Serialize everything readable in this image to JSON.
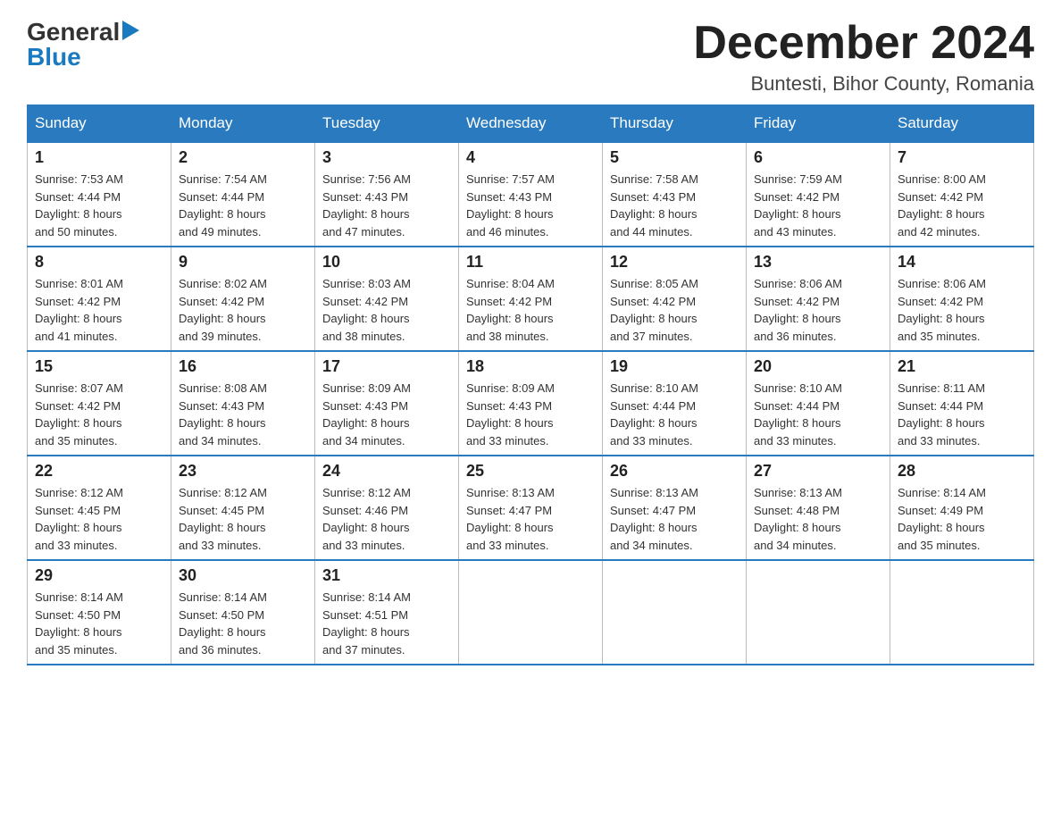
{
  "header": {
    "logo_general": "General",
    "logo_blue": "Blue",
    "month_title": "December 2024",
    "location": "Buntesti, Bihor County, Romania"
  },
  "days_of_week": [
    "Sunday",
    "Monday",
    "Tuesday",
    "Wednesday",
    "Thursday",
    "Friday",
    "Saturday"
  ],
  "weeks": [
    [
      {
        "day": "1",
        "sunrise": "7:53 AM",
        "sunset": "4:44 PM",
        "daylight": "8 hours and 50 minutes."
      },
      {
        "day": "2",
        "sunrise": "7:54 AM",
        "sunset": "4:44 PM",
        "daylight": "8 hours and 49 minutes."
      },
      {
        "day": "3",
        "sunrise": "7:56 AM",
        "sunset": "4:43 PM",
        "daylight": "8 hours and 47 minutes."
      },
      {
        "day": "4",
        "sunrise": "7:57 AM",
        "sunset": "4:43 PM",
        "daylight": "8 hours and 46 minutes."
      },
      {
        "day": "5",
        "sunrise": "7:58 AM",
        "sunset": "4:43 PM",
        "daylight": "8 hours and 44 minutes."
      },
      {
        "day": "6",
        "sunrise": "7:59 AM",
        "sunset": "4:42 PM",
        "daylight": "8 hours and 43 minutes."
      },
      {
        "day": "7",
        "sunrise": "8:00 AM",
        "sunset": "4:42 PM",
        "daylight": "8 hours and 42 minutes."
      }
    ],
    [
      {
        "day": "8",
        "sunrise": "8:01 AM",
        "sunset": "4:42 PM",
        "daylight": "8 hours and 41 minutes."
      },
      {
        "day": "9",
        "sunrise": "8:02 AM",
        "sunset": "4:42 PM",
        "daylight": "8 hours and 39 minutes."
      },
      {
        "day": "10",
        "sunrise": "8:03 AM",
        "sunset": "4:42 PM",
        "daylight": "8 hours and 38 minutes."
      },
      {
        "day": "11",
        "sunrise": "8:04 AM",
        "sunset": "4:42 PM",
        "daylight": "8 hours and 38 minutes."
      },
      {
        "day": "12",
        "sunrise": "8:05 AM",
        "sunset": "4:42 PM",
        "daylight": "8 hours and 37 minutes."
      },
      {
        "day": "13",
        "sunrise": "8:06 AM",
        "sunset": "4:42 PM",
        "daylight": "8 hours and 36 minutes."
      },
      {
        "day": "14",
        "sunrise": "8:06 AM",
        "sunset": "4:42 PM",
        "daylight": "8 hours and 35 minutes."
      }
    ],
    [
      {
        "day": "15",
        "sunrise": "8:07 AM",
        "sunset": "4:42 PM",
        "daylight": "8 hours and 35 minutes."
      },
      {
        "day": "16",
        "sunrise": "8:08 AM",
        "sunset": "4:43 PM",
        "daylight": "8 hours and 34 minutes."
      },
      {
        "day": "17",
        "sunrise": "8:09 AM",
        "sunset": "4:43 PM",
        "daylight": "8 hours and 34 minutes."
      },
      {
        "day": "18",
        "sunrise": "8:09 AM",
        "sunset": "4:43 PM",
        "daylight": "8 hours and 33 minutes."
      },
      {
        "day": "19",
        "sunrise": "8:10 AM",
        "sunset": "4:44 PM",
        "daylight": "8 hours and 33 minutes."
      },
      {
        "day": "20",
        "sunrise": "8:10 AM",
        "sunset": "4:44 PM",
        "daylight": "8 hours and 33 minutes."
      },
      {
        "day": "21",
        "sunrise": "8:11 AM",
        "sunset": "4:44 PM",
        "daylight": "8 hours and 33 minutes."
      }
    ],
    [
      {
        "day": "22",
        "sunrise": "8:12 AM",
        "sunset": "4:45 PM",
        "daylight": "8 hours and 33 minutes."
      },
      {
        "day": "23",
        "sunrise": "8:12 AM",
        "sunset": "4:45 PM",
        "daylight": "8 hours and 33 minutes."
      },
      {
        "day": "24",
        "sunrise": "8:12 AM",
        "sunset": "4:46 PM",
        "daylight": "8 hours and 33 minutes."
      },
      {
        "day": "25",
        "sunrise": "8:13 AM",
        "sunset": "4:47 PM",
        "daylight": "8 hours and 33 minutes."
      },
      {
        "day": "26",
        "sunrise": "8:13 AM",
        "sunset": "4:47 PM",
        "daylight": "8 hours and 34 minutes."
      },
      {
        "day": "27",
        "sunrise": "8:13 AM",
        "sunset": "4:48 PM",
        "daylight": "8 hours and 34 minutes."
      },
      {
        "day": "28",
        "sunrise": "8:14 AM",
        "sunset": "4:49 PM",
        "daylight": "8 hours and 35 minutes."
      }
    ],
    [
      {
        "day": "29",
        "sunrise": "8:14 AM",
        "sunset": "4:50 PM",
        "daylight": "8 hours and 35 minutes."
      },
      {
        "day": "30",
        "sunrise": "8:14 AM",
        "sunset": "4:50 PM",
        "daylight": "8 hours and 36 minutes."
      },
      {
        "day": "31",
        "sunrise": "8:14 AM",
        "sunset": "4:51 PM",
        "daylight": "8 hours and 37 minutes."
      },
      null,
      null,
      null,
      null
    ]
  ],
  "labels": {
    "sunrise": "Sunrise: ",
    "sunset": "Sunset: ",
    "daylight": "Daylight: "
  }
}
